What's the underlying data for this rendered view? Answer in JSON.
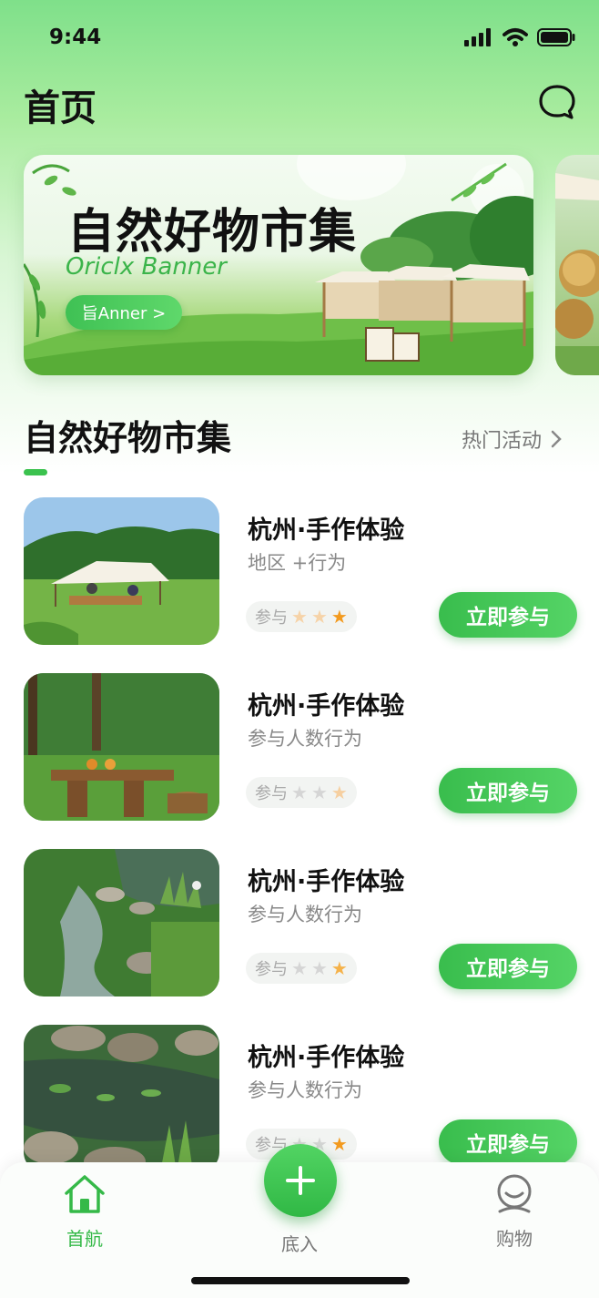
{
  "status_bar": {
    "time": "9:44"
  },
  "header": {
    "title": "首页",
    "chat_icon": "chat-bubble-icon"
  },
  "banner": {
    "title": "自然好物市集",
    "subtitle": "Oriclx Banner",
    "button_label": "旨Anner >"
  },
  "section": {
    "title": "自然好物市集",
    "more_label": "热门活动",
    "accent_color": "#3bc24e"
  },
  "cards": [
    {
      "title": "杭州·手作体验",
      "subtitle": "地区  +行为",
      "rating_label": "参与",
      "stars": 3,
      "star_style": "faded-two-orange-one",
      "button": "立即参与"
    },
    {
      "title": "杭州·手作体验",
      "subtitle": "参与人数行为",
      "rating_label": "参与",
      "stars": 3,
      "star_style": "grey-two-pale-one",
      "button": "立即参与"
    },
    {
      "title": "杭州·手作体验",
      "subtitle": "参与人数行为",
      "rating_label": "参与",
      "stars": 3,
      "star_style": "grey-two-orange-one",
      "button": "立即参与"
    },
    {
      "title": "杭州·手作体验",
      "subtitle": "参与人数行为",
      "rating_label": "参与",
      "stars": 3,
      "star_style": "grey-two-orange-one",
      "button": "立即参与"
    }
  ],
  "tabbar": {
    "items": [
      {
        "label": "首航",
        "icon": "home-icon",
        "active": true
      },
      {
        "label": "底入",
        "icon": "plus-icon",
        "active": false
      },
      {
        "label": "购物",
        "icon": "user-icon",
        "active": false
      }
    ],
    "active_color": "#35b948",
    "inactive_color": "#777777"
  }
}
